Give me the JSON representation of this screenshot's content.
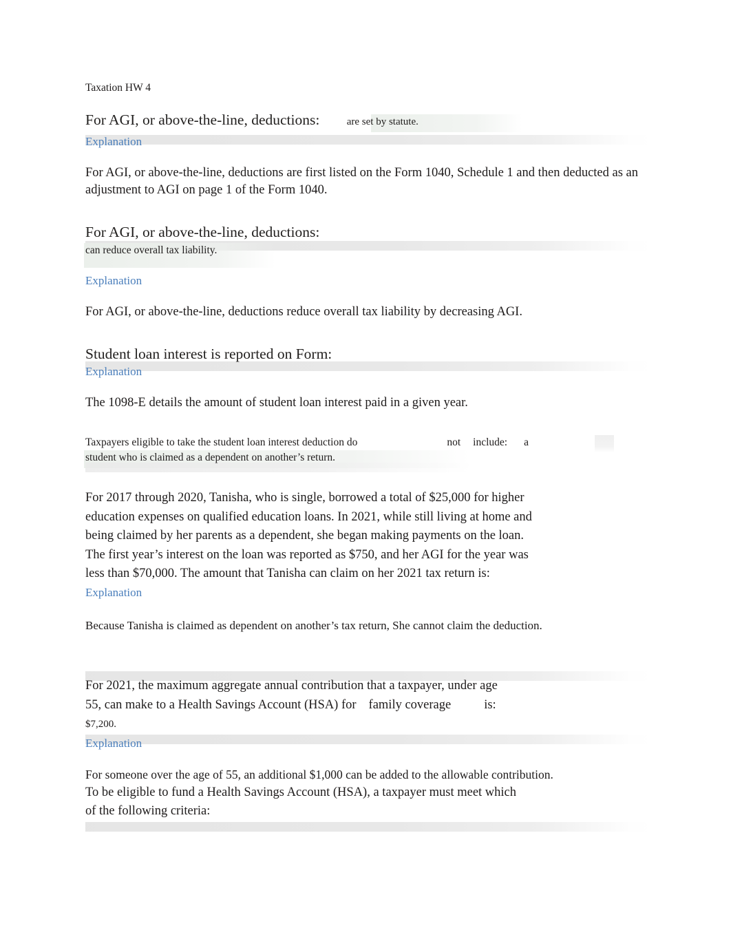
{
  "document": {
    "title": "Taxation HW 4"
  },
  "accent": {
    "link_color": "#4a7ebb",
    "text_color": "#1e1b1b",
    "highlight_band": "#e7e7e7",
    "tint_green": "#e9eee9"
  },
  "labels": {
    "explanation": "Explanation"
  },
  "questions": [
    {
      "prompt": "For  AGI, or above-the-line, deductions:",
      "answer": "are set by statute.",
      "explanation_label": "Explanation",
      "explanation_text": "For AGI, or above-the-line, deductions are first listed on the Form 1040, Schedule 1 and then deducted as an adjustment to AGI on page 1 of the Form 1040."
    },
    {
      "prompt": "For  AGI, or above-the-line, deductions:",
      "answer": "can reduce overall tax liability.",
      "explanation_label": "Explanation",
      "explanation_text": "For AGI, or above-the-line, deductions reduce overall tax liability by decreasing AGI."
    },
    {
      "prompt": "Student loan interest is reported on Form:",
      "explanation_label": "Explanation",
      "explanation_text": "The 1098-E details the amount of student loan interest paid in a given year."
    },
    {
      "prompt_part1": "Taxpayers eligible to take the student loan interest deduction do",
      "prompt_word_not": "not",
      "prompt_word_include": "include:",
      "answer_chip": "a",
      "answer_line2": "student who is claimed as a dependent on another’s return."
    },
    {
      "prompt": "For 2017 through 2020, Tanisha, who is single, borrowed a total of $25,000 for higher education expenses on qualified education loans. In 2021, while still living at home and being claimed by her parents as a dependent, she began making payments on the loan. The first year’s interest on the loan was reported as $750, and her AGI for the year was less than $70,000. The amount that Tanisha can claim on her 2021 tax return is:",
      "explanation_label": "Explanation",
      "explanation_text": "Because Tanisha is claimed as dependent on another’s tax return, She cannot claim the deduction."
    },
    {
      "prompt_part1": "For 2021, the maximum aggregate annual contribution that a taxpayer, under age 55, can make to a Health Savings Account (HSA) for",
      "prompt_blank": "family coverage",
      "prompt_part2": "is:",
      "answer": "$7,200.",
      "explanation_label": "Explanation",
      "explanation_text": "For someone over the age of 55, an additional $1,000 can be added to the allowable contribution."
    },
    {
      "prompt": "To be eligible to fund a Health Savings Account (HSA), a taxpayer must meet which of the following criteria:"
    }
  ]
}
